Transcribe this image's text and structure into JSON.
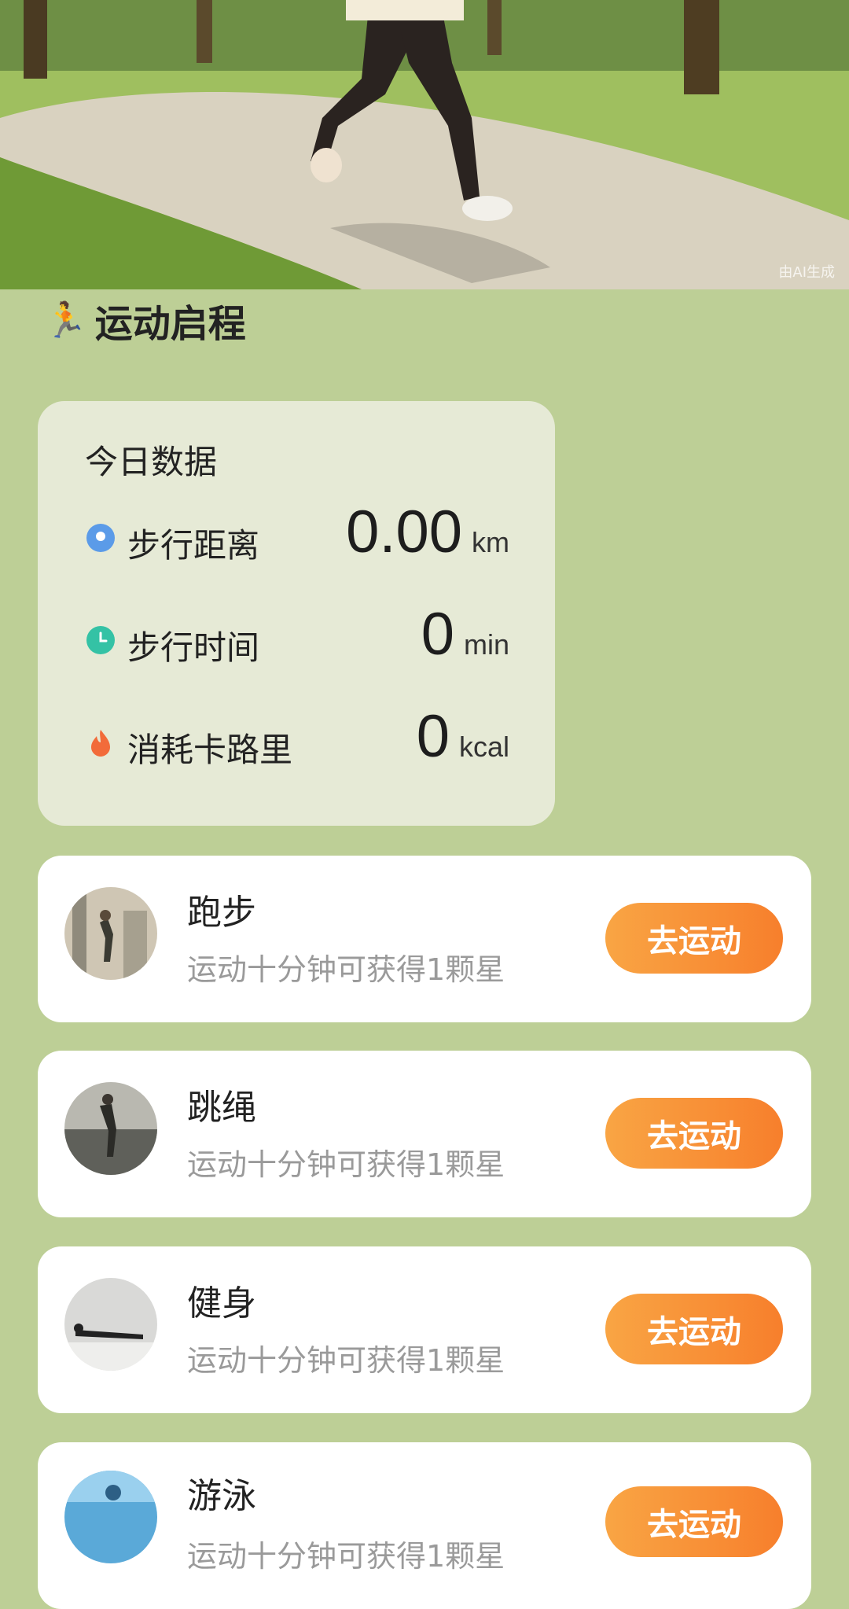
{
  "hero": {
    "watermark": "由AI生成"
  },
  "section": {
    "icon": "runner-icon",
    "title": "运动启程"
  },
  "stats": {
    "title": "今日数据",
    "rows": [
      {
        "icon": "location-pin-icon",
        "color": "#5b9be8",
        "label": "步行距离",
        "value": "0.00",
        "unit": "km"
      },
      {
        "icon": "clock-icon",
        "color": "#34c2a5",
        "label": "步行时间",
        "value": "0",
        "unit": "min"
      },
      {
        "icon": "flame-icon",
        "color": "#f26b3a",
        "label": "消耗卡路里",
        "value": "0",
        "unit": "kcal"
      }
    ]
  },
  "sports": [
    {
      "name": "跑步",
      "desc": "运动十分钟可获得1颗星",
      "button": "去运动"
    },
    {
      "name": "跳绳",
      "desc": "运动十分钟可获得1颗星",
      "button": "去运动"
    },
    {
      "name": "健身",
      "desc": "运动十分钟可获得1颗星",
      "button": "去运动"
    },
    {
      "name": "游泳",
      "desc": "运动十分钟可获得1颗星",
      "button": "去运动"
    }
  ],
  "colors": {
    "background": "#bdcf96",
    "button_start": "#f9a544",
    "button_end": "#f77f2c"
  }
}
